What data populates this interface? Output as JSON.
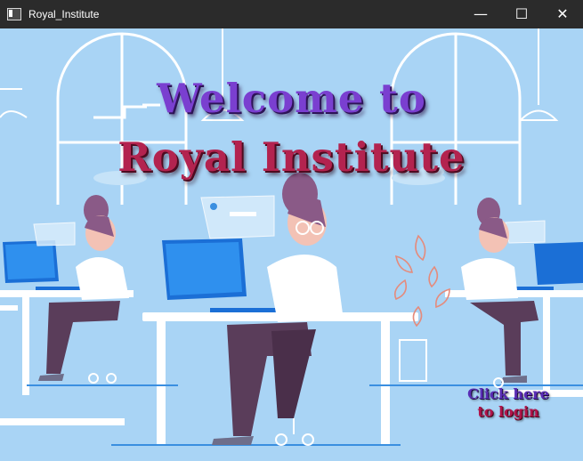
{
  "window": {
    "title": "Royal_Institute",
    "controls": {
      "minimize": "—",
      "maximize": "☐",
      "close": "✕"
    }
  },
  "welcome": {
    "line1": "Welcome to",
    "line2": "Royal Institute"
  },
  "login_link": {
    "line1": "Click here",
    "line2": "to login"
  },
  "colors": {
    "background": "#a9d4f5",
    "titlebar": "#2b2b2b",
    "heading_purple": "#7a3fd0",
    "heading_crimson": "#b3234f"
  }
}
